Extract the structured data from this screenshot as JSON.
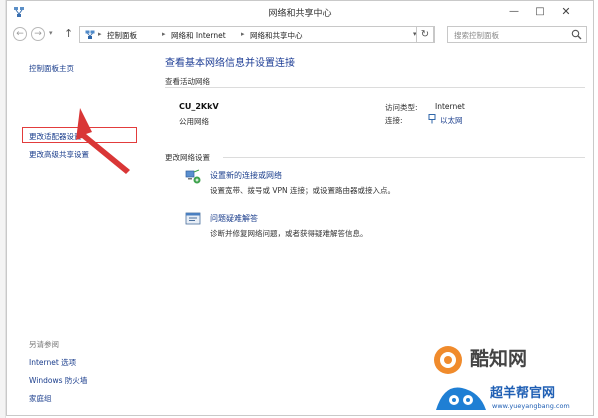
{
  "window": {
    "title": "网络和共享中心",
    "minimize": "—",
    "maximize": "□",
    "close": "✕"
  },
  "nav": {
    "back": "←",
    "forward": "→",
    "up": "↑",
    "dropdown": "▾",
    "refresh": "↻"
  },
  "breadcrumb": {
    "items": [
      "控制面板",
      "网络和 Internet",
      "网络和共享中心"
    ],
    "separator": "▸",
    "dropdown": "▾"
  },
  "search": {
    "placeholder": "搜索控制面板"
  },
  "sidebar": {
    "items": [
      {
        "label": "控制面板主页"
      },
      {
        "label": "更改适配器设置"
      },
      {
        "label": "更改高级共享设置"
      }
    ],
    "see_also_label": "另请参阅",
    "see_also": [
      {
        "label": "Internet 选项"
      },
      {
        "label": "Windows 防火墙"
      },
      {
        "label": "家庭组"
      }
    ]
  },
  "main": {
    "title": "查看基本网络信息并设置连接",
    "active_networks_label": "查看活动网络",
    "network": {
      "name": "CU_2KkV",
      "type": "公用网络",
      "access_type_label": "访问类型:",
      "access_type_value": "Internet",
      "connections_label": "连接:",
      "connection_value": "以太网"
    },
    "change_settings_label": "更改网络设置",
    "tasks": [
      {
        "title": "设置新的连接或网络",
        "description": "设置宽带、拨号或 VPN 连接；或设置路由器或接入点。"
      },
      {
        "title": "问题疑难解答",
        "description": "诊断并修复网络问题，或者获得疑难解答信息。"
      }
    ]
  },
  "watermark": {
    "text1": "酷知网",
    "text2": "超羊帮官网",
    "url": "www.yueyangbang.com"
  },
  "colors": {
    "link": "#1a3d8c",
    "title": "#1e3e96",
    "highlight": "#e23c3c"
  }
}
